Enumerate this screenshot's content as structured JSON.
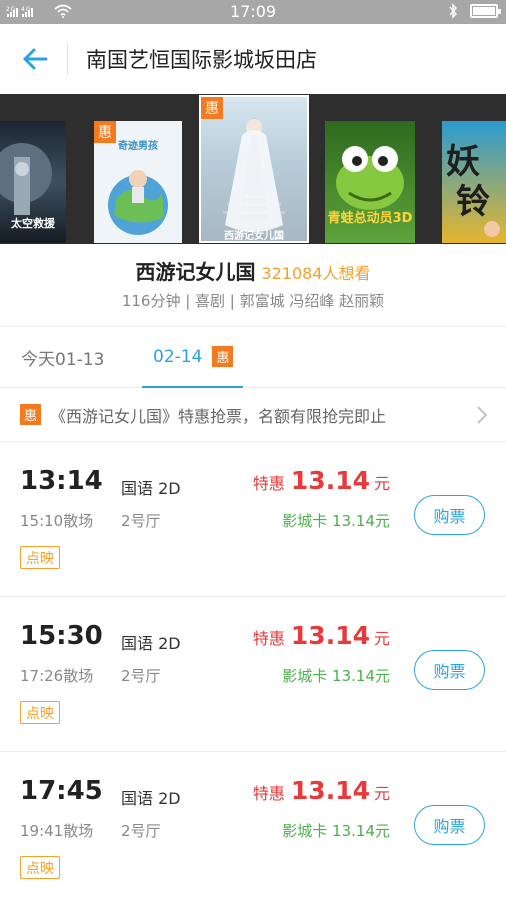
{
  "status_bar": {
    "signal": "2G 4G",
    "time": "17:09"
  },
  "header": {
    "title": "南国艺恒国际影城坂田店"
  },
  "posters": [
    {
      "title": "太空救援",
      "has_deal": false
    },
    {
      "title": "奇迹男孩",
      "has_deal": true,
      "deal_label": "惠"
    },
    {
      "title": "西游记女儿国",
      "has_deal": true,
      "deal_label": "惠",
      "selected": true
    },
    {
      "title": "青蛙总动员3D",
      "has_deal": false
    },
    {
      "title": "",
      "has_deal": false
    }
  ],
  "movie": {
    "title": "西游记女儿国",
    "wants": "321084人想看",
    "meta": "116分钟 | 喜剧 | 郭富城 冯绍峰 赵丽颖"
  },
  "date_tabs": [
    {
      "label": "今天01-13",
      "active": false
    },
    {
      "label": "02-14",
      "badge": "惠",
      "active": true
    }
  ],
  "promo": {
    "badge": "惠",
    "text": "《西游记女儿国》特惠抢票，名额有限抢完即止"
  },
  "showtimes": [
    {
      "time": "13:14",
      "end": "15:10散场",
      "lang": "国语 2D",
      "hall": "2号厅",
      "price_label": "特惠",
      "price": "13.14",
      "unit": "元",
      "card_price": "影城卡 13.14元",
      "buy_label": "购票",
      "tag": "点映"
    },
    {
      "time": "15:30",
      "end": "17:26散场",
      "lang": "国语 2D",
      "hall": "2号厅",
      "price_label": "特惠",
      "price": "13.14",
      "unit": "元",
      "card_price": "影城卡 13.14元",
      "buy_label": "购票",
      "tag": "点映"
    },
    {
      "time": "17:45",
      "end": "19:41散场",
      "lang": "国语 2D",
      "hall": "2号厅",
      "price_label": "特惠",
      "price": "13.14",
      "unit": "元",
      "card_price": "影城卡 13.14元",
      "buy_label": "购票",
      "tag": "点映"
    }
  ],
  "colors": {
    "accent_blue": "#2ba3e0",
    "deal_orange": "#f47a20",
    "price_red": "#e83a3a",
    "card_green": "#4cb04c",
    "tag_orange": "#f4a12a"
  }
}
